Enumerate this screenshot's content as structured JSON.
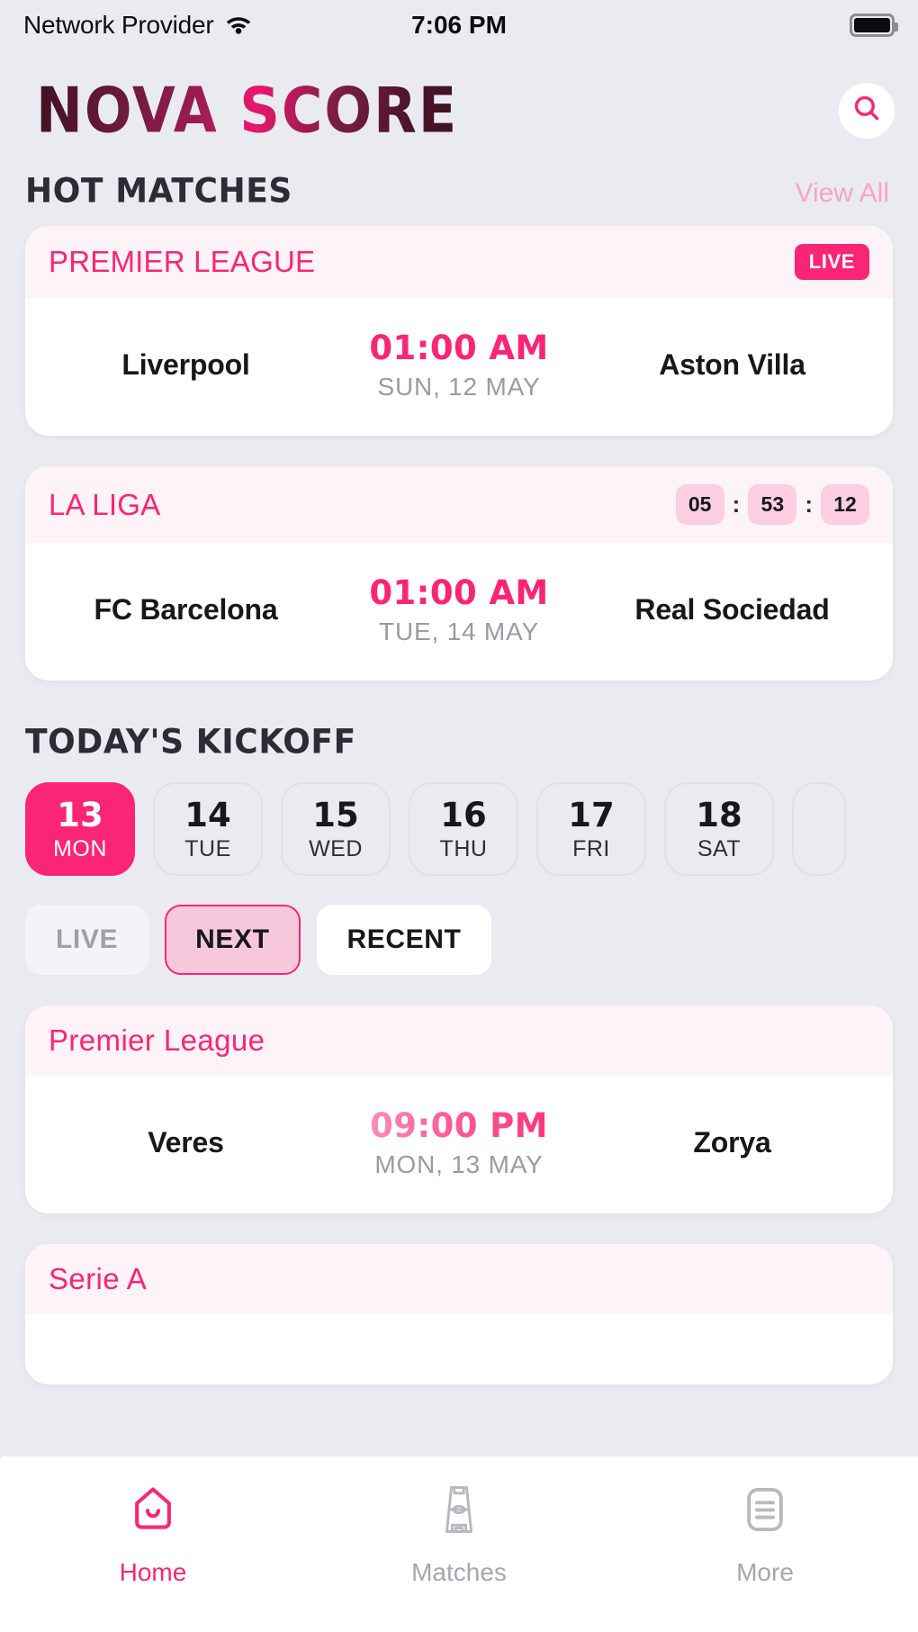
{
  "status_bar": {
    "carrier": "Network Provider",
    "time": "7:06 PM",
    "wifi_icon": "wifi-icon",
    "battery_icon": "battery-full-icon"
  },
  "header": {
    "logo": "NOVA SCORE",
    "search_icon": "search-icon"
  },
  "hot_matches": {
    "title": "HOT MATCHES",
    "view_all": "View All",
    "cards": [
      {
        "league": "PREMIER LEAGUE",
        "badge_type": "live",
        "badge_label": "LIVE",
        "home": "Liverpool",
        "away": "Aston Villa",
        "time": "01:00 AM",
        "date": "SUN, 12 MAY"
      },
      {
        "league": "LA LIGA",
        "badge_type": "countdown",
        "countdown": {
          "hours": "05",
          "minutes": "53",
          "seconds": "12",
          "separator": ":"
        },
        "home": "FC Barcelona",
        "away": "Real Sociedad",
        "time": "01:00 AM",
        "date": "TUE, 14 MAY"
      }
    ]
  },
  "todays_kickoff": {
    "title": "TODAY'S KICKOFF",
    "dates": [
      {
        "num": "13",
        "dow": "MON",
        "selected": true
      },
      {
        "num": "14",
        "dow": "TUE",
        "selected": false
      },
      {
        "num": "15",
        "dow": "WED",
        "selected": false
      },
      {
        "num": "16",
        "dow": "THU",
        "selected": false
      },
      {
        "num": "17",
        "dow": "FRI",
        "selected": false
      },
      {
        "num": "18",
        "dow": "SAT",
        "selected": false
      }
    ],
    "filters": [
      {
        "label": "LIVE",
        "state": "muted"
      },
      {
        "label": "NEXT",
        "state": "active"
      },
      {
        "label": "RECENT",
        "state": "plain"
      }
    ],
    "matches": [
      {
        "league": "Premier League",
        "home": "Veres",
        "away": "Zorya",
        "time": "09:00 PM",
        "date": "MON, 13 MAY"
      },
      {
        "league": "Serie A",
        "home": "",
        "away": "",
        "time": "",
        "date": ""
      }
    ]
  },
  "tabbar": {
    "items": [
      {
        "label": "Home",
        "icon": "home-icon",
        "active": true
      },
      {
        "label": "Matches",
        "icon": "pitch-icon",
        "active": false
      },
      {
        "label": "More",
        "icon": "list-icon",
        "active": false
      }
    ]
  },
  "colors": {
    "accent": "#FB2576",
    "accent_soft": "#F7C8DC",
    "card_head": "#FEF3F6",
    "page_bg": "#EAEBF0",
    "muted_text": "#9B9BA4"
  }
}
